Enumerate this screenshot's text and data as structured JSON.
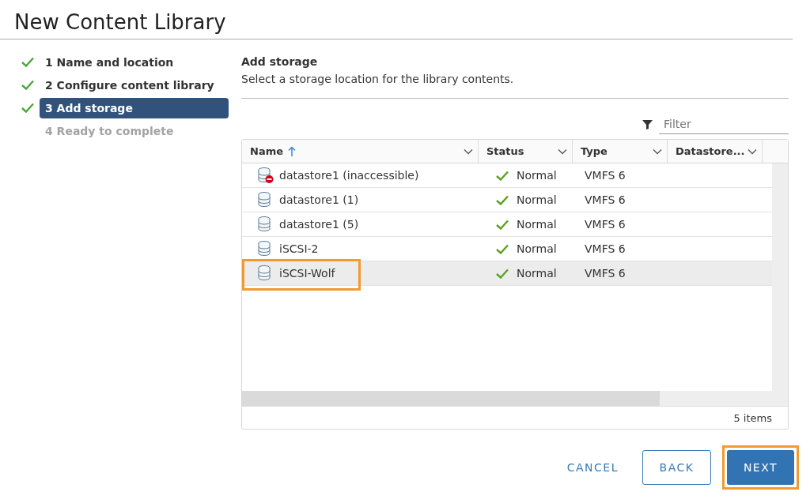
{
  "window": {
    "title": "New Content Library"
  },
  "steps": [
    {
      "label": "1 Name and location",
      "done": true,
      "selected": false,
      "disabled": false
    },
    {
      "label": "2 Configure content library",
      "done": true,
      "selected": false,
      "disabled": false
    },
    {
      "label": "3 Add storage",
      "done": true,
      "selected": true,
      "disabled": false
    },
    {
      "label": "4 Ready to complete",
      "done": false,
      "selected": false,
      "disabled": true
    }
  ],
  "section": {
    "title": "Add storage",
    "description": "Select a storage location for the library contents."
  },
  "filter": {
    "placeholder": "Filter"
  },
  "table": {
    "columns": [
      {
        "label": "Name",
        "sorted": true
      },
      {
        "label": "Status",
        "sorted": false
      },
      {
        "label": "Type",
        "sorted": false
      },
      {
        "label": "Datastore...",
        "sorted": false
      }
    ],
    "rows": [
      {
        "name": "datastore1 (inaccessible)",
        "inaccessible": true,
        "status": "Normal",
        "type": "VMFS 6",
        "selected": false,
        "highlighted": false
      },
      {
        "name": "datastore1 (1)",
        "inaccessible": false,
        "status": "Normal",
        "type": "VMFS 6",
        "selected": false,
        "highlighted": false
      },
      {
        "name": "datastore1 (5)",
        "inaccessible": false,
        "status": "Normal",
        "type": "VMFS 6",
        "selected": false,
        "highlighted": false
      },
      {
        "name": "iSCSI-2",
        "inaccessible": false,
        "status": "Normal",
        "type": "VMFS 6",
        "selected": false,
        "highlighted": false
      },
      {
        "name": "iSCSI-Wolf",
        "inaccessible": false,
        "status": "Normal",
        "type": "VMFS 6",
        "selected": true,
        "highlighted": true
      }
    ],
    "footer": "5 items"
  },
  "buttons": [
    {
      "label": "CANCEL",
      "kind": "flat",
      "highlighted": false
    },
    {
      "label": "BACK",
      "kind": "outline",
      "highlighted": false
    },
    {
      "label": "NEXT",
      "kind": "primary",
      "highlighted": true
    }
  ]
}
